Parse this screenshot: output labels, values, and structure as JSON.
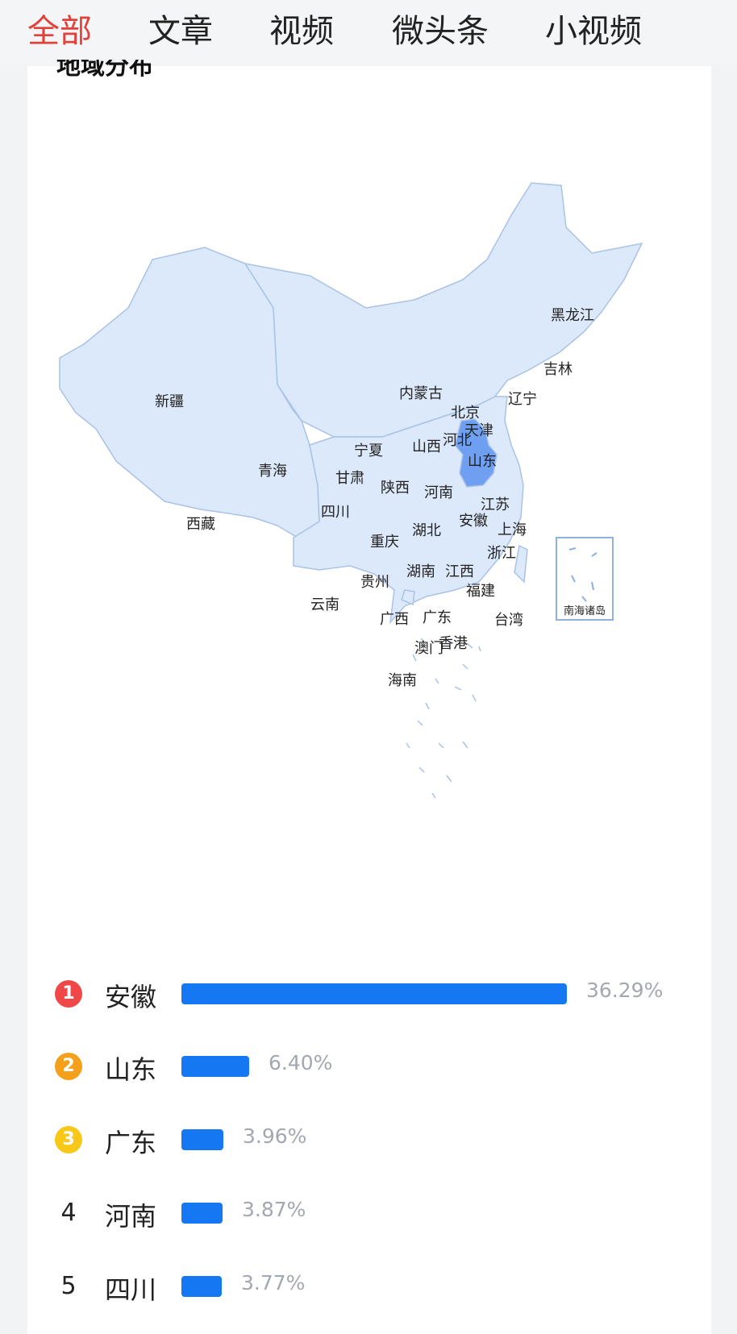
{
  "tabs": [
    {
      "label": "全部",
      "active": true
    },
    {
      "label": "文章",
      "active": false
    },
    {
      "label": "视频",
      "active": false
    },
    {
      "label": "微头条",
      "active": false
    },
    {
      "label": "小视频",
      "active": false
    }
  ],
  "section_title": "地域分布",
  "map": {
    "highlight_province": "安徽",
    "highlight_color": "#6f9ff0",
    "base_color": "#dce9fb",
    "border_color": "#a9c2e6",
    "inset_label": "南海诸岛",
    "province_labels": [
      "黑龙江",
      "吉林",
      "辽宁",
      "内蒙古",
      "北京",
      "天津",
      "河北",
      "山西",
      "新疆",
      "宁夏",
      "青海",
      "甘肃",
      "陕西",
      "河南",
      "山东",
      "江苏",
      "安徽",
      "上海",
      "西藏",
      "四川",
      "重庆",
      "湖北",
      "浙江",
      "贵州",
      "湖南",
      "江西",
      "福建",
      "云南",
      "广西",
      "广东",
      "台湾",
      "香港",
      "澳门",
      "海南"
    ]
  },
  "ranking": [
    {
      "rank": "1",
      "name": "安徽",
      "percent": "36.29%",
      "value": 36.29,
      "badge_color": "#f04848"
    },
    {
      "rank": "2",
      "name": "山东",
      "percent": "6.40%",
      "value": 6.4,
      "badge_color": "#f5a01a"
    },
    {
      "rank": "3",
      "name": "广东",
      "percent": "3.96%",
      "value": 3.96,
      "badge_color": "#f7c818"
    },
    {
      "rank": "4",
      "name": "河南",
      "percent": "3.87%",
      "value": 3.87,
      "badge_color": ""
    },
    {
      "rank": "5",
      "name": "四川",
      "percent": "3.77%",
      "value": 3.77,
      "badge_color": ""
    }
  ],
  "colors": {
    "accent": "#e0413a",
    "bar": "#1677f2"
  }
}
